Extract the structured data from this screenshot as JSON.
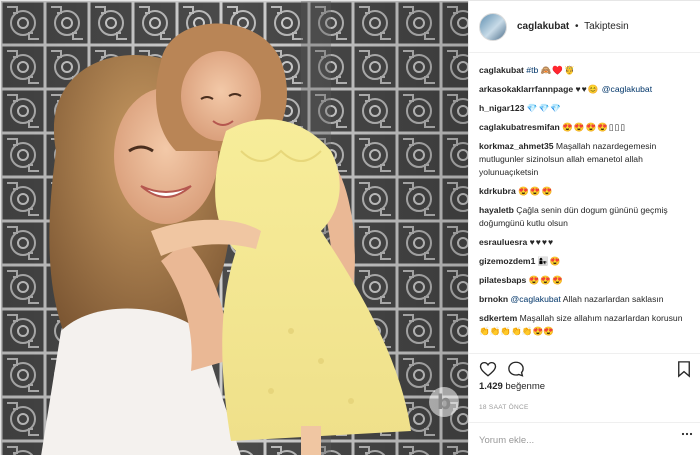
{
  "header": {
    "username": "caglakubat",
    "separator": "•",
    "follow_status": "Takiptesin"
  },
  "comments": [
    {
      "user": "caglakubat",
      "text": "#tb",
      "emoji": "🙈♥️🤴"
    },
    {
      "user": "arkasokaklarrfannpage",
      "text": "♥♥😊",
      "mention": "@caglakubat"
    },
    {
      "user": "h_nigar123",
      "text": "💎💎💎"
    },
    {
      "user": "caglakubatresmifan",
      "text": "😍😍😍😍▯▯▯"
    },
    {
      "user": "korkmaz_ahmet35",
      "text": "Maşallah nazardegemesin mutlugunler sizinolsun allah emanetol allah yolunuaçıketsin"
    },
    {
      "user": "kdrkubra",
      "text": "😍😍😍"
    },
    {
      "user": "hayaletb",
      "text": "Çağla senin dün dogum gününü geçmiş doğumgünü kutlu olsun"
    },
    {
      "user": "esrauluesra",
      "text": "♥♥♥♥"
    },
    {
      "user": "gizemozdem1",
      "text": "👩‍👧😍"
    },
    {
      "user": "pilatesbaps",
      "text": "😍😍😍"
    },
    {
      "user": "brnokn",
      "mention": "@caglakubat",
      "text": "Allah nazarlardan saklasın"
    },
    {
      "user": "sdkertem",
      "text": "Maşallah size allahım nazarlardan korusun👏👏👏👏👏😍😍"
    }
  ],
  "likes": {
    "count": "1.429",
    "label": "beğenme"
  },
  "timestamp": "18 SAAT ÖNCE",
  "add_comment": {
    "placeholder": "Yorum ekle..."
  },
  "watermark": "b",
  "icons": [
    "heart-icon",
    "comment-icon",
    "bookmark-icon",
    "more-icon"
  ]
}
